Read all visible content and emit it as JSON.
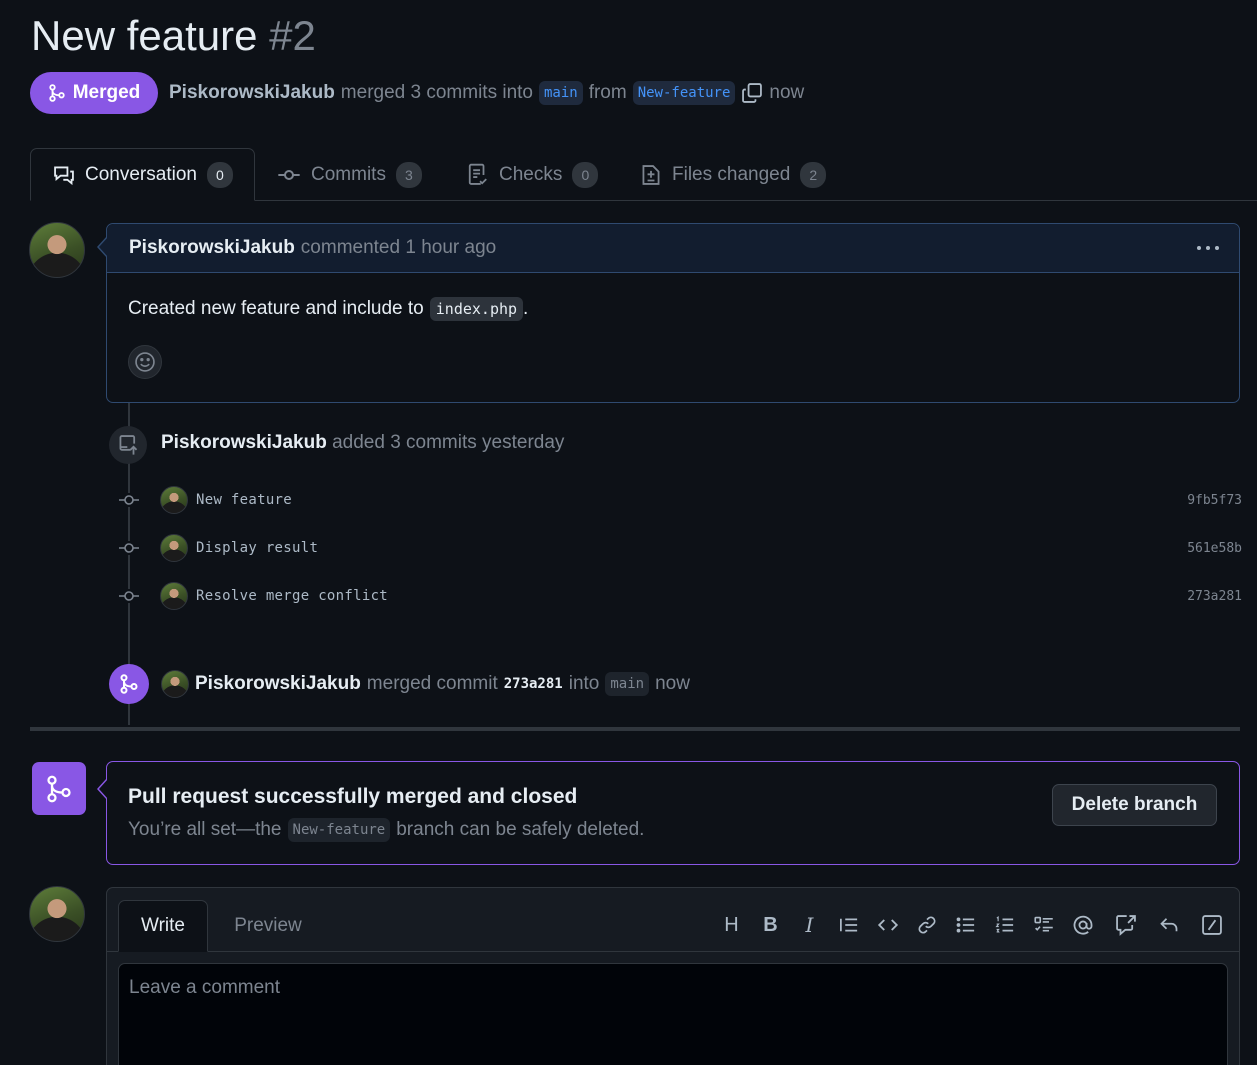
{
  "header": {
    "title": "New feature",
    "number": "#2",
    "state_badge": "Merged",
    "author": "PiskorowskiJakub",
    "merged_text": "merged 3 commits into",
    "base_branch": "main",
    "from_text": "from",
    "head_branch": "New-feature",
    "time": "now"
  },
  "tabs": [
    {
      "label": "Conversation",
      "count": "0",
      "icon": "comment-discussion-icon"
    },
    {
      "label": "Commits",
      "count": "3",
      "icon": "git-commit-icon"
    },
    {
      "label": "Checks",
      "count": "0",
      "icon": "checklist-icon"
    },
    {
      "label": "Files changed",
      "count": "2",
      "icon": "file-diff-icon"
    }
  ],
  "comment": {
    "author": "PiskorowskiJakub",
    "action": "commented 1 hour ago",
    "body_text": "Created new feature and include to",
    "body_code": "index.php",
    "body_end": "."
  },
  "push_event": {
    "author": "PiskorowskiJakub",
    "text": "added 3 commits yesterday"
  },
  "commits": [
    {
      "message": "New feature",
      "sha": "9fb5f73"
    },
    {
      "message": "Display result",
      "sha": "561e58b"
    },
    {
      "message": "Resolve merge conflict",
      "sha": "273a281"
    }
  ],
  "merge_event": {
    "author": "PiskorowskiJakub",
    "text1": "merged commit",
    "sha": "273a281",
    "text2": "into",
    "branch": "main",
    "time": "now"
  },
  "merge_box": {
    "title": "Pull request successfully merged and closed",
    "sub_before": "You’re all set—the",
    "branch": "New-feature",
    "sub_after": "branch can be safely deleted.",
    "delete_button": "Delete branch"
  },
  "editor": {
    "write_tab": "Write",
    "preview_tab": "Preview",
    "placeholder": "Leave a comment",
    "heading_btn": "H",
    "bold_btn": "B",
    "italic_btn": "I"
  },
  "colors": {
    "merged": "#8957e5",
    "link": "#4493f8",
    "background": "#0d1117"
  }
}
